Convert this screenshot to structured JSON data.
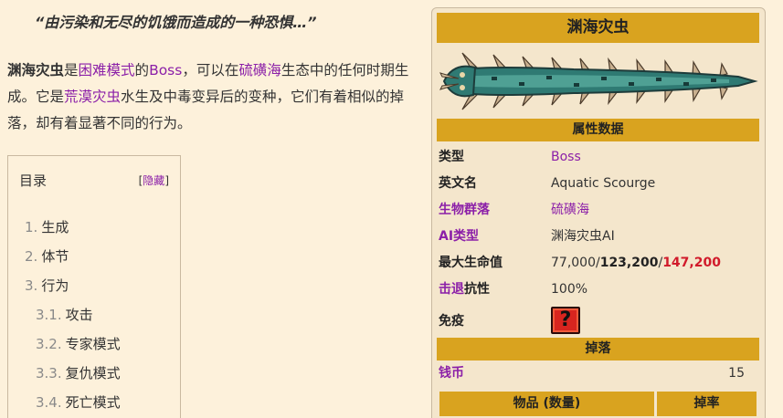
{
  "quote": "“由污染和无尽的饥饿而造成的一种恐惧…”",
  "intro": {
    "boss_name": "渊海灾虫",
    "t1": "是",
    "link_hard": "困难模式",
    "t2": "的",
    "link_boss": "Boss",
    "t3": "，可以在",
    "link_sulphur": "硫磺海",
    "t4": "生态中的任何时期生成。它是",
    "link_desert": "荒漠灾虫",
    "t5": "水生及中毒变异后的变种，它们有着相似的掉落，却有着显著不同的行为。"
  },
  "toc": {
    "title": "目录",
    "hide_open": "[",
    "hide_label": "隐藏",
    "hide_close": "]",
    "items": [
      {
        "num": "1.",
        "label": "生成"
      },
      {
        "num": "2.",
        "label": "体节"
      },
      {
        "num": "3.",
        "label": "行为"
      },
      {
        "num": "3.1.",
        "label": "攻击"
      },
      {
        "num": "3.2.",
        "label": "专家模式"
      },
      {
        "num": "3.3.",
        "label": "复仇模式"
      },
      {
        "num": "3.4.",
        "label": "死亡模式"
      }
    ]
  },
  "infobox": {
    "title": "渊海灾虫",
    "section_stats": "属性数据",
    "type_key": "类型",
    "type_val": "Boss",
    "en_key": "英文名",
    "en_val": "Aquatic Scourge",
    "biome_key": "生物群落",
    "biome_val": "硫磺海",
    "ai_key": "AI类型",
    "ai_val": "渊海灾虫AI",
    "hp_key": "最大生命值",
    "hp_normal": "77,000/",
    "hp_expert": "123,200",
    "hp_sep": "/",
    "hp_master": "147,200",
    "kb_key_link": "击退",
    "kb_key_rest": "抗性",
    "kb_val": "100%",
    "immune_key": "免疫",
    "immune_icon": "?",
    "section_drops": "掉落",
    "coin_key": "钱币",
    "coin_val": "15",
    "col_item": "物品 (数量)",
    "col_rate": "掉率"
  },
  "colors": {
    "gold": "#d9a31f",
    "link": "#8b1fa8",
    "master": "#d11a2a",
    "background": "#fdf1db"
  }
}
